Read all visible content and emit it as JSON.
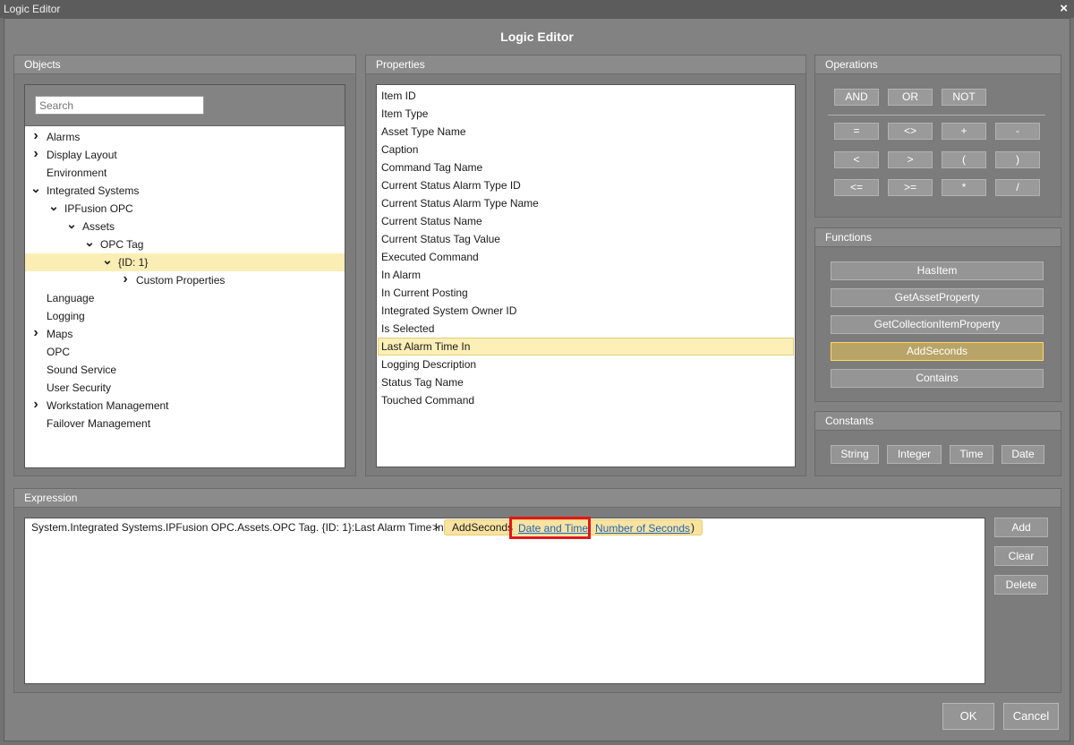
{
  "window": {
    "title": "Logic Editor",
    "close_glyph": "×"
  },
  "dialog": {
    "title": "Logic Editor"
  },
  "objects": {
    "header": "Objects",
    "search_placeholder": "Search",
    "tree": [
      {
        "label": "Alarms",
        "expander": "right",
        "selected": false
      },
      {
        "label": "Display Layout",
        "expander": "right",
        "selected": false
      },
      {
        "label": "Environment",
        "expander": "none",
        "selected": false
      },
      {
        "label": "Integrated Systems",
        "expander": "down",
        "selected": false
      },
      {
        "label": "IPFusion OPC",
        "expander": "down",
        "selected": false
      },
      {
        "label": "Assets",
        "expander": "down",
        "selected": false
      },
      {
        "label": "OPC Tag",
        "expander": "down",
        "selected": false
      },
      {
        "label": "{ID: 1}",
        "expander": "down",
        "selected": true
      },
      {
        "label": "Custom Properties",
        "expander": "right",
        "selected": false
      },
      {
        "label": "Language",
        "expander": "none",
        "selected": false
      },
      {
        "label": "Logging",
        "expander": "none",
        "selected": false
      },
      {
        "label": "Maps",
        "expander": "right",
        "selected": false
      },
      {
        "label": "OPC",
        "expander": "none",
        "selected": false
      },
      {
        "label": "Sound Service",
        "expander": "none",
        "selected": false
      },
      {
        "label": "User Security",
        "expander": "none",
        "selected": false
      },
      {
        "label": "Workstation Management",
        "expander": "right",
        "selected": false
      },
      {
        "label": "Failover Management",
        "expander": "none",
        "selected": false
      }
    ]
  },
  "properties": {
    "header": "Properties",
    "items": [
      "Item ID",
      "Item Type",
      "Asset Type Name",
      "Caption",
      "Command Tag Name",
      "Current Status Alarm Type ID",
      "Current Status Alarm Type Name",
      "Current Status Name",
      "Current Status Tag Value",
      "Executed Command",
      "In Alarm",
      "In Current Posting",
      "Integrated System Owner ID",
      "Is Selected",
      "Last Alarm Time In",
      "Logging Description",
      "Status Tag Name",
      "Touched Command"
    ],
    "selected": "Last Alarm Time In"
  },
  "operations": {
    "header": "Operations",
    "logic": [
      "AND",
      "OR",
      "NOT"
    ],
    "row1": [
      "=",
      "<>",
      "+",
      "-"
    ],
    "row2": [
      "<",
      ">",
      "(",
      ")"
    ],
    "row3": [
      "<=",
      ">=",
      "*",
      "/"
    ]
  },
  "functions": {
    "header": "Functions",
    "items": [
      "HasItem",
      "GetAssetProperty",
      "GetCollectionItemProperty",
      "AddSeconds",
      "Contains"
    ],
    "selected": "AddSeconds"
  },
  "constants": {
    "header": "Constants",
    "items": [
      "String",
      "Integer",
      "Time",
      "Date"
    ]
  },
  "expression": {
    "header": "Expression",
    "path": "System.Integrated Systems.IPFusion OPC.Assets.OPC Tag. {ID: 1}:Last Alarm Time In",
    "operator": ">",
    "function": "AddSeconds",
    "arg1": "Date and Time",
    "arg2": "Number of Seconds",
    "close_paren": ")",
    "buttons": {
      "add": "Add",
      "clear": "Clear",
      "delete": "Delete"
    }
  },
  "footer": {
    "ok": "OK",
    "cancel": "Cancel"
  }
}
